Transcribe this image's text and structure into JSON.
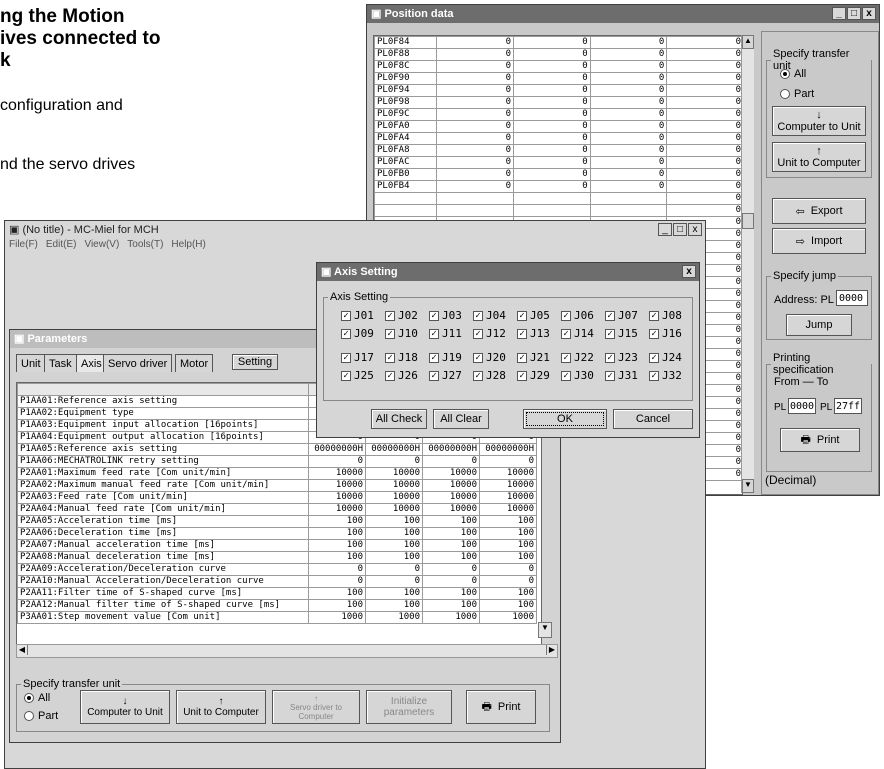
{
  "page": {
    "heading": [
      "ng the Motion",
      "ives connected to",
      "k"
    ],
    "body": [
      "configuration and",
      "nd the servo drives"
    ]
  },
  "position_window": {
    "title": "Position data",
    "rows": [
      {
        "label": "PL0F84",
        "v": [
          "0",
          "0",
          "0",
          "0"
        ]
      },
      {
        "label": "PL0F88",
        "v": [
          "0",
          "0",
          "0",
          "0"
        ]
      },
      {
        "label": "PL0F8C",
        "v": [
          "0",
          "0",
          "0",
          "0"
        ]
      },
      {
        "label": "PL0F90",
        "v": [
          "0",
          "0",
          "0",
          "0"
        ]
      },
      {
        "label": "PL0F94",
        "v": [
          "0",
          "0",
          "0",
          "0"
        ]
      },
      {
        "label": "PL0F98",
        "v": [
          "0",
          "0",
          "0",
          "0"
        ]
      },
      {
        "label": "PL0F9C",
        "v": [
          "0",
          "0",
          "0",
          "0"
        ]
      },
      {
        "label": "PL0FA0",
        "v": [
          "0",
          "0",
          "0",
          "0"
        ]
      },
      {
        "label": "PL0FA4",
        "v": [
          "0",
          "0",
          "0",
          "0"
        ]
      },
      {
        "label": "PL0FA8",
        "v": [
          "0",
          "0",
          "0",
          "0"
        ]
      },
      {
        "label": "PL0FAC",
        "v": [
          "0",
          "0",
          "0",
          "0"
        ]
      },
      {
        "label": "PL0FB0",
        "v": [
          "0",
          "0",
          "0",
          "0"
        ]
      },
      {
        "label": "PL0FB4",
        "v": [
          "0",
          "0",
          "0",
          "0"
        ]
      }
    ],
    "right_col_count": 37,
    "right_col_value": "0",
    "transfer_legend": "Specify transfer unit",
    "radio_all": "All",
    "radio_part": "Part",
    "computer_to_unit": "Computer to Unit",
    "unit_to_computer": "Unit to Computer",
    "export": "Export",
    "import": "Import",
    "jump_legend": "Specify jump",
    "address_label": "Address: PL",
    "address_value": "0000",
    "jump": "Jump",
    "print_legend": "Printing specification",
    "from_to": "From — To",
    "pl": "PL",
    "from_value": "0000",
    "to_value": "27ff",
    "print": "Print",
    "decimal": "(Decimal)"
  },
  "main_window": {
    "title": "(No title) - MC-Miel for MCH",
    "menu": [
      "File(F)",
      "Edit(E)",
      "View(V)",
      "Tools(T)",
      "Help(H)"
    ]
  },
  "params_window": {
    "title": "Parameters",
    "tabs": [
      "Unit",
      "Task",
      "Axis",
      "Servo driver",
      "Motor"
    ],
    "setting": "Setting",
    "rows": [
      {
        "name": "P1AA01:Reference axis setting",
        "v": [
          "",
          "",
          "",
          ""
        ]
      },
      {
        "name": "P1AA02:Equipment type",
        "v": [
          "",
          "",
          "",
          ""
        ]
      },
      {
        "name": "P1AA03:Equipment input allocation [16points]",
        "v": [
          "",
          "",
          "",
          ""
        ]
      },
      {
        "name": "P1AA04:Equipment output allocation [16points]",
        "v": [
          "0",
          "0",
          "0",
          "0"
        ]
      },
      {
        "name": "P1AA05:Reference axis setting",
        "v": [
          "00000000H",
          "00000000H",
          "00000000H",
          "00000000H"
        ]
      },
      {
        "name": "P1AA06:MECHATROLINK retry setting",
        "v": [
          "0",
          "0",
          "0",
          "0"
        ]
      },
      {
        "name": "P2AA01:Maximum feed rate [Com unit/min]",
        "v": [
          "10000",
          "10000",
          "10000",
          "10000"
        ]
      },
      {
        "name": "P2AA02:Maximum manual feed rate [Com unit/min]",
        "v": [
          "10000",
          "10000",
          "10000",
          "10000"
        ]
      },
      {
        "name": "P2AA03:Feed rate [Com unit/min]",
        "v": [
          "10000",
          "10000",
          "10000",
          "10000"
        ]
      },
      {
        "name": "P2AA04:Manual feed rate [Com unit/min]",
        "v": [
          "10000",
          "10000",
          "10000",
          "10000"
        ]
      },
      {
        "name": "P2AA05:Acceleration time [ms]",
        "v": [
          "100",
          "100",
          "100",
          "100"
        ]
      },
      {
        "name": "P2AA06:Deceleration time [ms]",
        "v": [
          "100",
          "100",
          "100",
          "100"
        ]
      },
      {
        "name": "P2AA07:Manual acceleration time [ms]",
        "v": [
          "100",
          "100",
          "100",
          "100"
        ]
      },
      {
        "name": "P2AA08:Manual deceleration time [ms]",
        "v": [
          "100",
          "100",
          "100",
          "100"
        ]
      },
      {
        "name": "P2AA09:Acceleration/Deceleration curve",
        "v": [
          "0",
          "0",
          "0",
          "0"
        ]
      },
      {
        "name": "P2AA10:Manual Acceleration/Deceleration curve",
        "v": [
          "0",
          "0",
          "0",
          "0"
        ]
      },
      {
        "name": "P2AA11:Filter time of S-shaped curve [ms]",
        "v": [
          "100",
          "100",
          "100",
          "100"
        ]
      },
      {
        "name": "P2AA12:Manual filter time of S-shaped curve [ms]",
        "v": [
          "100",
          "100",
          "100",
          "100"
        ]
      },
      {
        "name": "P3AA01:Step movement value [Com unit]",
        "v": [
          "1000",
          "1000",
          "1000",
          "1000"
        ]
      }
    ],
    "transfer_legend": "Specify transfer unit",
    "radio_all": "All",
    "radio_part": "Part",
    "computer_to_unit": "Computer to Unit",
    "unit_to_computer": "Unit to Computer",
    "servo_to_computer": "Servo driver to Computer",
    "initialize": "Initialize parameters",
    "print": "Print"
  },
  "axis_dialog": {
    "title": "Axis Setting",
    "group": "Axis Setting",
    "axes": [
      "J01",
      "J02",
      "J03",
      "J04",
      "J05",
      "J06",
      "J07",
      "J08",
      "J09",
      "J10",
      "J11",
      "J12",
      "J13",
      "J14",
      "J15",
      "J16",
      "J17",
      "J18",
      "J19",
      "J20",
      "J21",
      "J22",
      "J23",
      "J24",
      "J25",
      "J26",
      "J27",
      "J28",
      "J29",
      "J30",
      "J31",
      "J32"
    ],
    "all_check": "All Check",
    "all_clear": "All Clear",
    "ok": "OK",
    "cancel": "Cancel"
  }
}
